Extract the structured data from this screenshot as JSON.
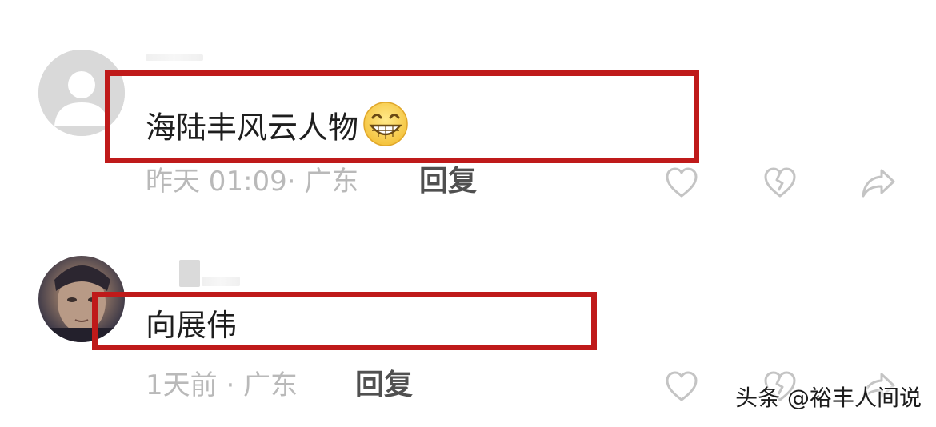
{
  "comments": [
    {
      "text": "海陆丰风云人物",
      "emoji": "grinning-face",
      "time_location": "昨天 01:09· 广东",
      "reply_label": "回复"
    },
    {
      "text": "向展伟",
      "time_location": "1天前 · 广东",
      "reply_label": "回复"
    }
  ],
  "watermark": "头条 @裕丰人间说",
  "colors": {
    "highlight_border": "#bf1a1a",
    "meta_text": "#b9b9b9",
    "icon_stroke": "#c4c4c4"
  },
  "icons": [
    "heart-icon",
    "broken-heart-icon",
    "share-icon"
  ]
}
